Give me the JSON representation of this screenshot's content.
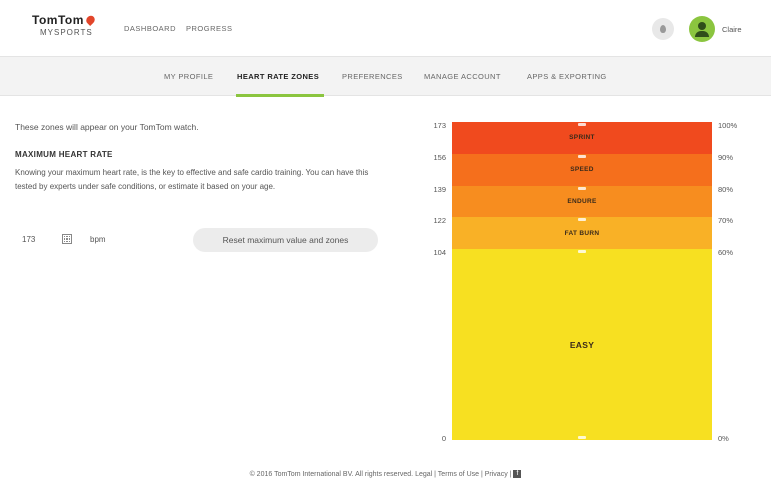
{
  "brand": {
    "name": "TomTom",
    "sub": "MYSPORTS"
  },
  "topnav": [
    {
      "label": "DASHBOARD"
    },
    {
      "label": "PROGRESS"
    }
  ],
  "user": {
    "name": "Claire"
  },
  "subnav": [
    {
      "label": "MY PROFILE",
      "active": false
    },
    {
      "label": "HEART RATE ZONES",
      "active": true
    },
    {
      "label": "PREFERENCES",
      "active": false
    },
    {
      "label": "MANAGE ACCOUNT",
      "active": false
    },
    {
      "label": "APPS & EXPORTING",
      "active": false
    }
  ],
  "main": {
    "intro": "These zones will appear on your TomTom watch.",
    "section_title": "MAXIMUM HEART RATE",
    "description": "Knowing your maximum heart rate, is the key to effective and safe cardio training. You can have this tested by experts under safe conditions, or estimate it based on your age.",
    "max_hr_value": "173",
    "unit": "bpm",
    "reset_label": "Reset maximum value and zones"
  },
  "zones": {
    "max_bpm": 173,
    "items": [
      {
        "label": "SPRINT",
        "color": "#f04a1e",
        "from_pct": 90,
        "to_pct": 100
      },
      {
        "label": "SPEED",
        "color": "#f56f1c",
        "from_pct": 80,
        "to_pct": 90
      },
      {
        "label": "ENDURE",
        "color": "#f78d1f",
        "from_pct": 70,
        "to_pct": 80
      },
      {
        "label": "FAT BURN",
        "color": "#f9b126",
        "from_pct": 60,
        "to_pct": 70
      },
      {
        "label": "EASY",
        "color": "#f7e021",
        "from_pct": 0,
        "to_pct": 60
      }
    ],
    "bpm_ticks": [
      "173",
      "156",
      "139",
      "122",
      "104",
      "0"
    ],
    "pct_ticks": [
      "100%",
      "90%",
      "80%",
      "70%",
      "60%",
      "0%"
    ]
  },
  "footer": {
    "copyright": "© 2016 TomTom International BV. All rights reserved.",
    "links": [
      "Legal",
      "Terms of Use",
      "Privacy"
    ]
  }
}
